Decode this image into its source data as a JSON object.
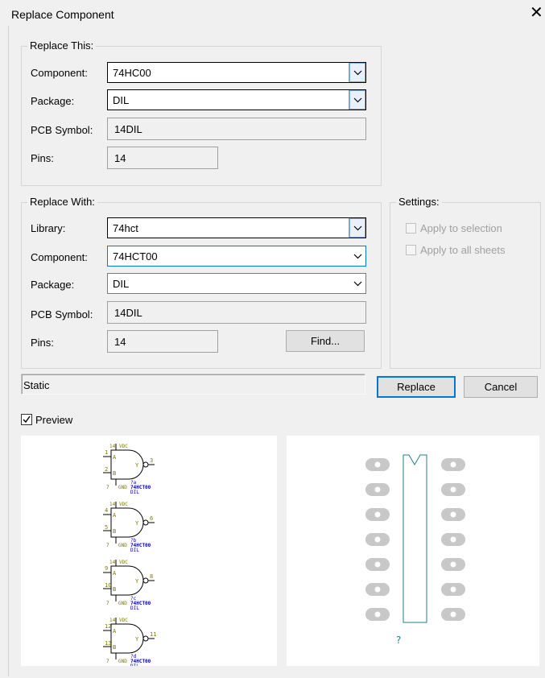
{
  "window": {
    "title": "Replace Component",
    "close_glyph": "✕"
  },
  "replace_this": {
    "legend": "Replace This:",
    "component_label": "Component:",
    "component_value": "74HC00",
    "package_label": "Package:",
    "package_value": "DIL",
    "pcb_label": "PCB Symbol:",
    "pcb_value": "14DIL",
    "pins_label": "Pins:",
    "pins_value": "14"
  },
  "replace_with": {
    "legend": "Replace With:",
    "library_label": "Library:",
    "library_value": "74hct",
    "component_label": "Component:",
    "component_value": "74HCT00",
    "package_label": "Package:",
    "package_value": "DIL",
    "pcb_label": "PCB Symbol:",
    "pcb_value": "14DIL",
    "pins_label": "Pins:",
    "pins_value": "14",
    "find_label": "Find..."
  },
  "settings": {
    "legend": "Settings:",
    "apply_selection": {
      "label": "Apply to selection",
      "checked": false,
      "enabled": false
    },
    "apply_all_sheets": {
      "label": "Apply to all sheets",
      "checked": false,
      "enabled": false
    }
  },
  "status_text": "Static",
  "buttons": {
    "replace": "Replace",
    "cancel": "Cancel"
  },
  "preview": {
    "label": "Preview",
    "checked": true,
    "schematic_gates": [
      {
        "in_a": "1",
        "in_b": "2",
        "out": "3",
        "gate_tag": "?a",
        "part": "74HCT00",
        "pkg": "DIL"
      },
      {
        "in_a": "4",
        "in_b": "5",
        "out": "6",
        "gate_tag": "?b",
        "part": "74HCT00",
        "pkg": "DIL"
      },
      {
        "in_a": "9",
        "in_b": "10",
        "out": "8",
        "gate_tag": "?c",
        "part": "74HCT00",
        "pkg": "DIL"
      },
      {
        "in_a": "12",
        "in_b": "13",
        "out": "11",
        "gate_tag": "?d",
        "part": "74HCT00",
        "pkg": "DIL"
      }
    ],
    "power_pin": "14",
    "power_net": "VDC",
    "gnd_pin": "7",
    "gnd_net": "GND",
    "pin_a": "A",
    "pin_b": "B",
    "pin_y": "Y",
    "pcb_pins_per_side": 7,
    "pcb_refdes": "?"
  },
  "colors": {
    "accent": "#0078d7",
    "schematic_body": "#7a7a00",
    "schematic_text": "#0000c0",
    "pcb_outline": "#1f7f8f",
    "pad": "#c8c8c8"
  }
}
